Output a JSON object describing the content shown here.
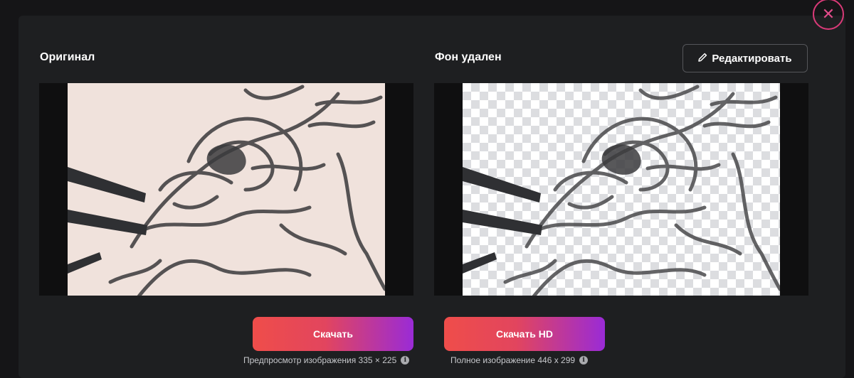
{
  "original": {
    "title": "Оригинал"
  },
  "removed": {
    "title": "Фон удален",
    "edit_label": "Редактировать"
  },
  "close": {
    "icon": "close-icon",
    "color": "#d93a78"
  },
  "download": {
    "preview_label": "Скачать",
    "hd_label": "Скачать HD",
    "preview_caption": "Предпросмотр изображения 335 × 225",
    "hd_caption": "Полное изображение 446 x 299",
    "gradient": [
      "#ef4d4a",
      "#9a2bd6"
    ]
  }
}
